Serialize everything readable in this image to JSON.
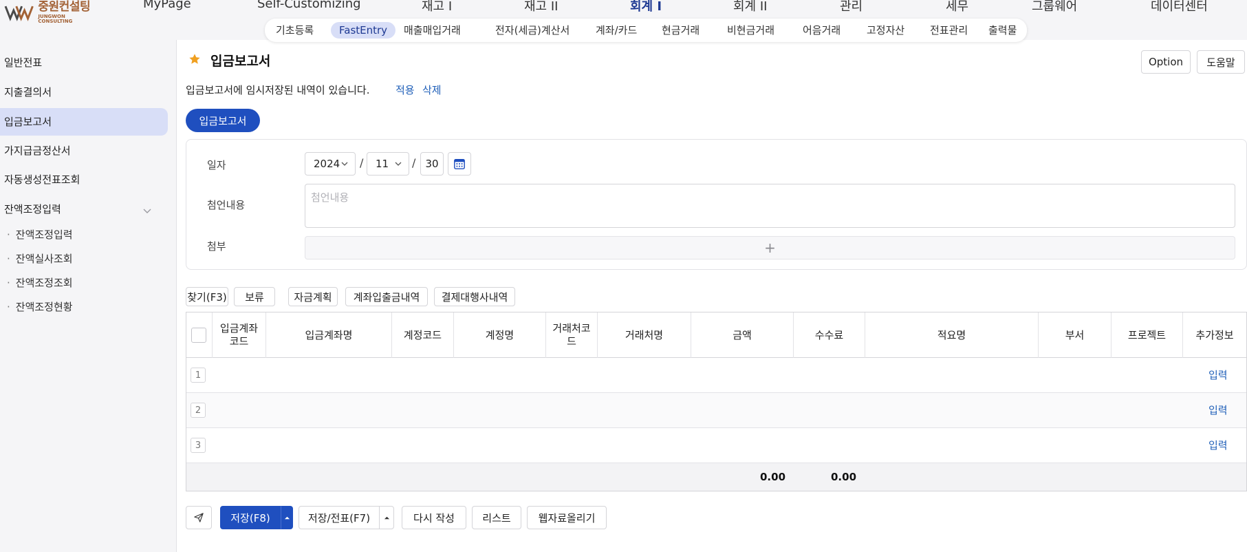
{
  "logo": {
    "name_kor": "중원컨설팅",
    "name_eng": "JUNGWON CONSULTING"
  },
  "main_menu": [
    "MyPage",
    "Self-Customizing",
    "재고 I",
    "재고 II",
    "회계 I",
    "회계 II",
    "관리",
    "세무",
    "그룹웨어",
    "데이터센터"
  ],
  "main_menu_active": "회계 I",
  "sub_tabs": [
    "기초등록",
    "FastEntry",
    "매출매입거래",
    "전자(세금)계산서",
    "계좌/카드",
    "현금거래",
    "비현금거래",
    "어음거래",
    "고정자산",
    "전표관리",
    "출력물"
  ],
  "sub_tabs_active": "FastEntry",
  "sidebar": {
    "items": [
      "일반전표",
      "지출결의서",
      "입금보고서",
      "가지급금정산서",
      "자동생성전표조회",
      "잔액조정입력"
    ],
    "active": "입금보고서",
    "sub_items": [
      "잔액조정입력",
      "잔액실사조회",
      "잔액조정조회",
      "잔액조정현황"
    ]
  },
  "page": {
    "title": "입금보고서",
    "option_label": "Option",
    "help_label": "도움말",
    "notice": "입금보고서에 임시저장된 내역이 있습니다.",
    "apply_link": "적용",
    "delete_link": "삭제",
    "pill_label": "입금보고서"
  },
  "form": {
    "date_label": "일자",
    "year": "2024",
    "month": "11",
    "day": "30",
    "memo_label": "첨언내용",
    "memo_placeholder": "첨언내용",
    "attach_label": "첨부",
    "attach_plus": "+"
  },
  "toolbar": [
    "찾기(F3)",
    "보류",
    "자금계획",
    "계좌입출금내역",
    "결제대행사내역"
  ],
  "table": {
    "columns": [
      "입금계좌\n코드",
      "입금계좌명",
      "계정코드",
      "계정명",
      "거래처코\n드",
      "거래처명",
      "금액",
      "수수료",
      "적요명",
      "부서",
      "프로젝트",
      "추가정보"
    ],
    "rows": [
      {
        "num": "1",
        "link": "입력"
      },
      {
        "num": "2",
        "link": "입력"
      },
      {
        "num": "3",
        "link": "입력"
      }
    ],
    "total_amount": "0.00",
    "total_fee": "0.00"
  },
  "bottom_buttons": {
    "save": "저장(F8)",
    "save_slip": "저장/전표(F7)",
    "rewrite": "다시 작성",
    "list": "리스트",
    "web_upload": "웹자료올리기"
  },
  "colors": {
    "primary": "#1f4fbf",
    "active_bg": "#d8def7",
    "link": "#1f5fb8",
    "logo": "#a36236",
    "star": "#f0a020"
  }
}
